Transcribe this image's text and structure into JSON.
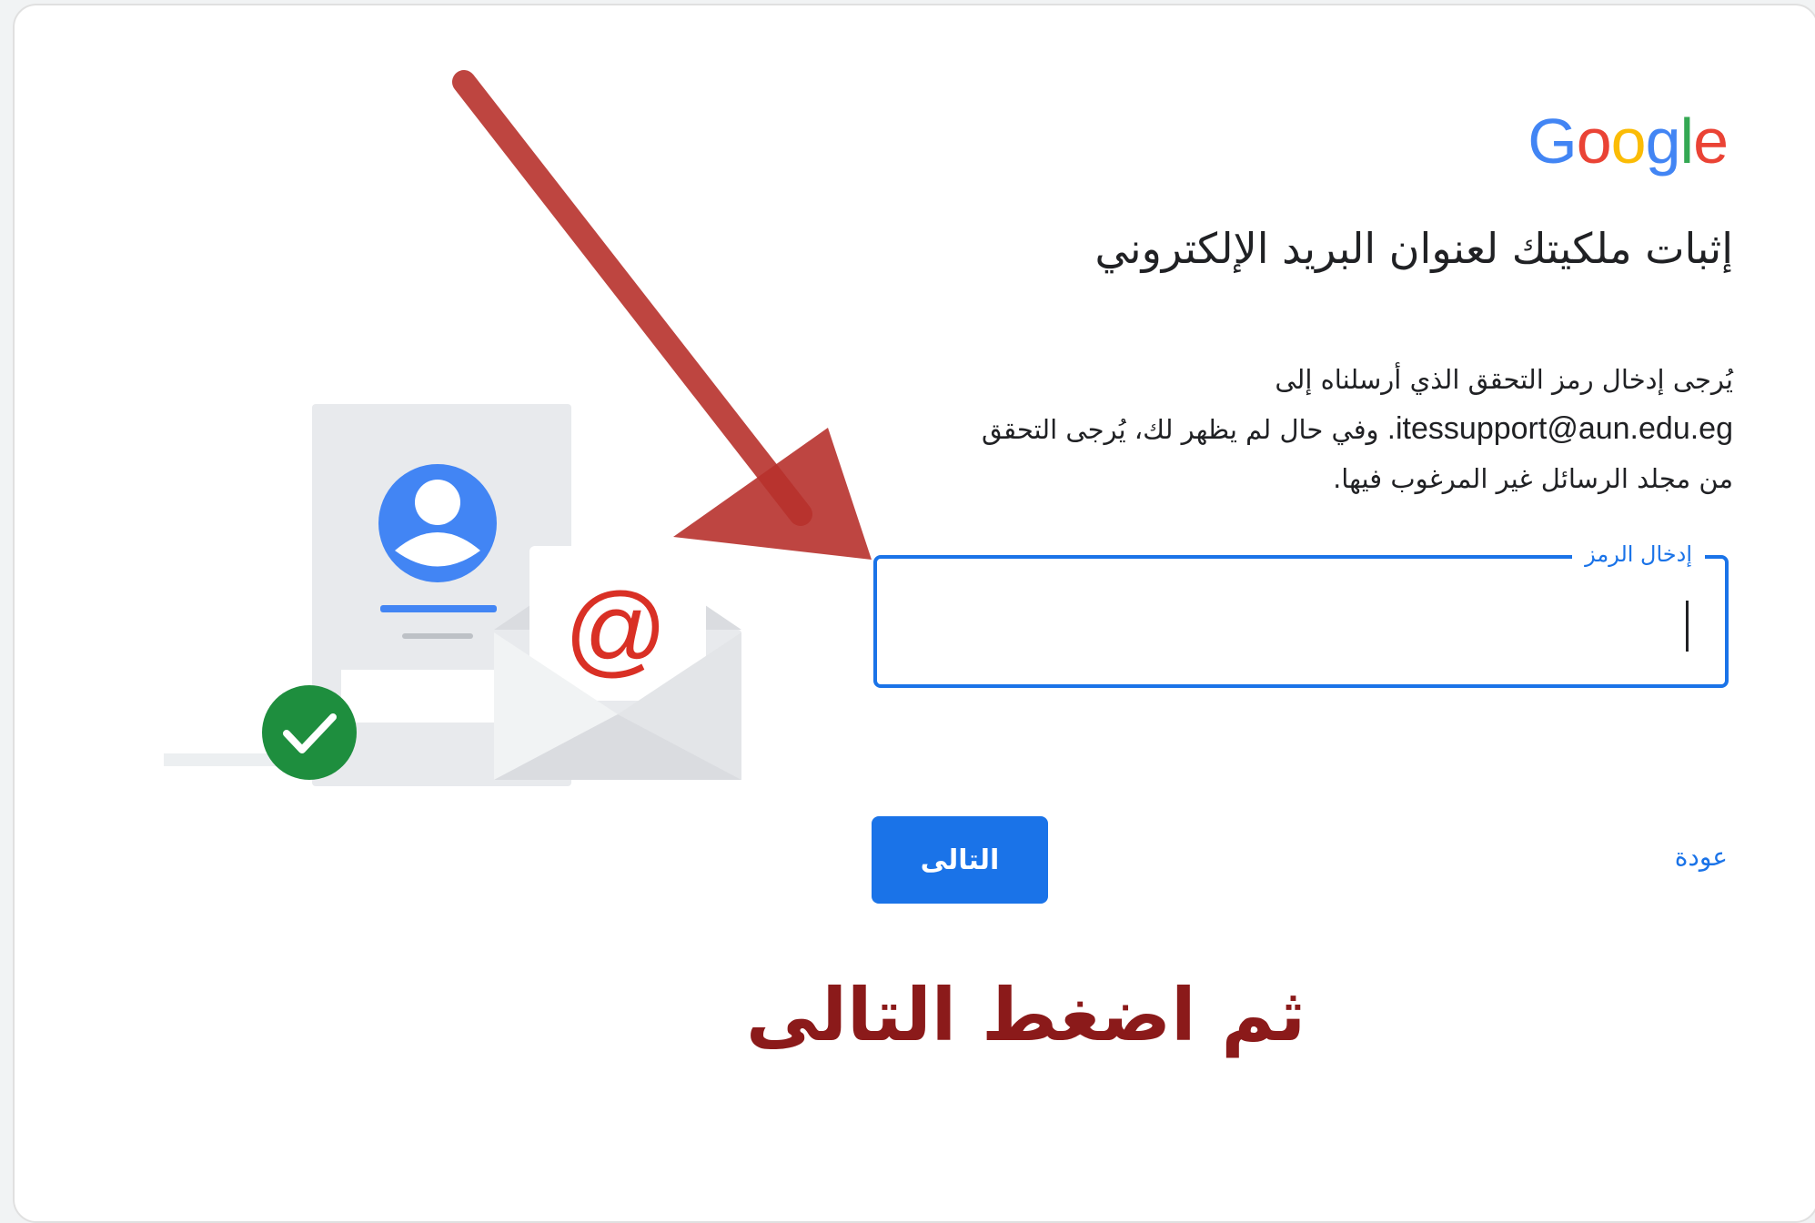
{
  "annotations": {
    "bottom_caption": "ثم اضغط التالى"
  },
  "logo": {
    "text": "Google"
  },
  "page": {
    "heading": "إثبات ملكيتك لعنوان البريد الإلكتروني",
    "description_line1": "يُرجى إدخال رمز التحقق الذي أرسلناه إلى",
    "email": "itessupport@aun.edu.eg",
    "description_line2_rest": ". وفي حال لم يظهر لك، يُرجى التحقق",
    "description_line3": "من مجلد الرسائل غير المرغوب فيها."
  },
  "code_field": {
    "label": "إدخال الرمز",
    "value": ""
  },
  "buttons": {
    "next": "التالى",
    "back": "عودة"
  },
  "colors": {
    "accent": "#1a73e8",
    "annotation": "#8b1a1a",
    "success": "#1e8e3e",
    "avatar": "#4285f4",
    "at_sign": "#d93025"
  },
  "icons": [
    "contact-card-icon",
    "avatar-icon",
    "envelope-icon",
    "at-sign-icon",
    "checkmark-icon",
    "annotation-arrow"
  ]
}
